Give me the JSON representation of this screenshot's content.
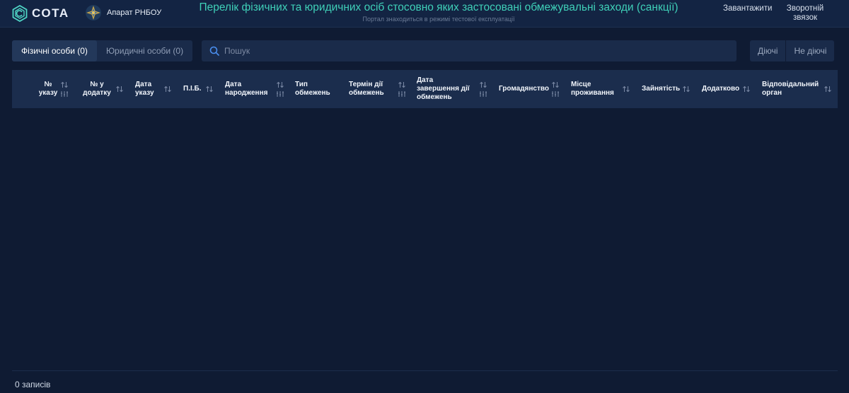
{
  "header": {
    "brand": "СОТА",
    "org": "Апарат РНБОУ",
    "title": "Перелік фізичних та юридичних осіб стосовно яких застосовані обмежувальні заходи (санкції)",
    "subtitle": "Портал знаходиться в режимі тестової експлуатації",
    "nav": {
      "download": "Завантажити",
      "feedback_line1": "Зворотній",
      "feedback_line2": "звязок"
    }
  },
  "toolbar": {
    "tabs": [
      {
        "label": "Фізичні особи (0)",
        "active": true
      },
      {
        "label": "Юридичні особи (0)",
        "active": false
      }
    ],
    "search_placeholder": "Пошук",
    "status": {
      "active": "Діючі",
      "inactive": "Не діючі"
    }
  },
  "table": {
    "columns": [
      {
        "line1": "№",
        "line2": "указу",
        "filter": true
      },
      {
        "line1": "№ у",
        "line2": "додатку",
        "filter": false
      },
      {
        "line1": "Дата",
        "line2": "указу",
        "filter": false
      },
      {
        "line1": "П.І.Б.",
        "line2": "",
        "filter": false
      },
      {
        "line1": "Дата",
        "line2": "народження",
        "filter": true
      },
      {
        "line1": "Тип",
        "line2": "обмежень",
        "filter": false
      },
      {
        "line1": "Термін дії",
        "line2": "обмежень",
        "filter": true
      },
      {
        "line1": "Дата",
        "line2": "завершення дії",
        "line3": "обмежень",
        "filter": true
      },
      {
        "line1": "Громадянство",
        "line2": "",
        "filter": true
      },
      {
        "line1": "Місце",
        "line2": "проживання",
        "filter": false
      },
      {
        "line1": "Зайнятість",
        "line2": "",
        "filter": false
      },
      {
        "line1": "Додатково",
        "line2": "",
        "filter": false
      },
      {
        "line1": "Відповідальний",
        "line2": "орган",
        "filter": false
      }
    ],
    "rows": []
  },
  "footer": {
    "count": "0 записів"
  },
  "colors": {
    "accent": "#3fd0b8",
    "background": "#0f1b33",
    "header": "#132443",
    "panel": "#1a2b4a",
    "search_icon": "#4a8ff0"
  }
}
